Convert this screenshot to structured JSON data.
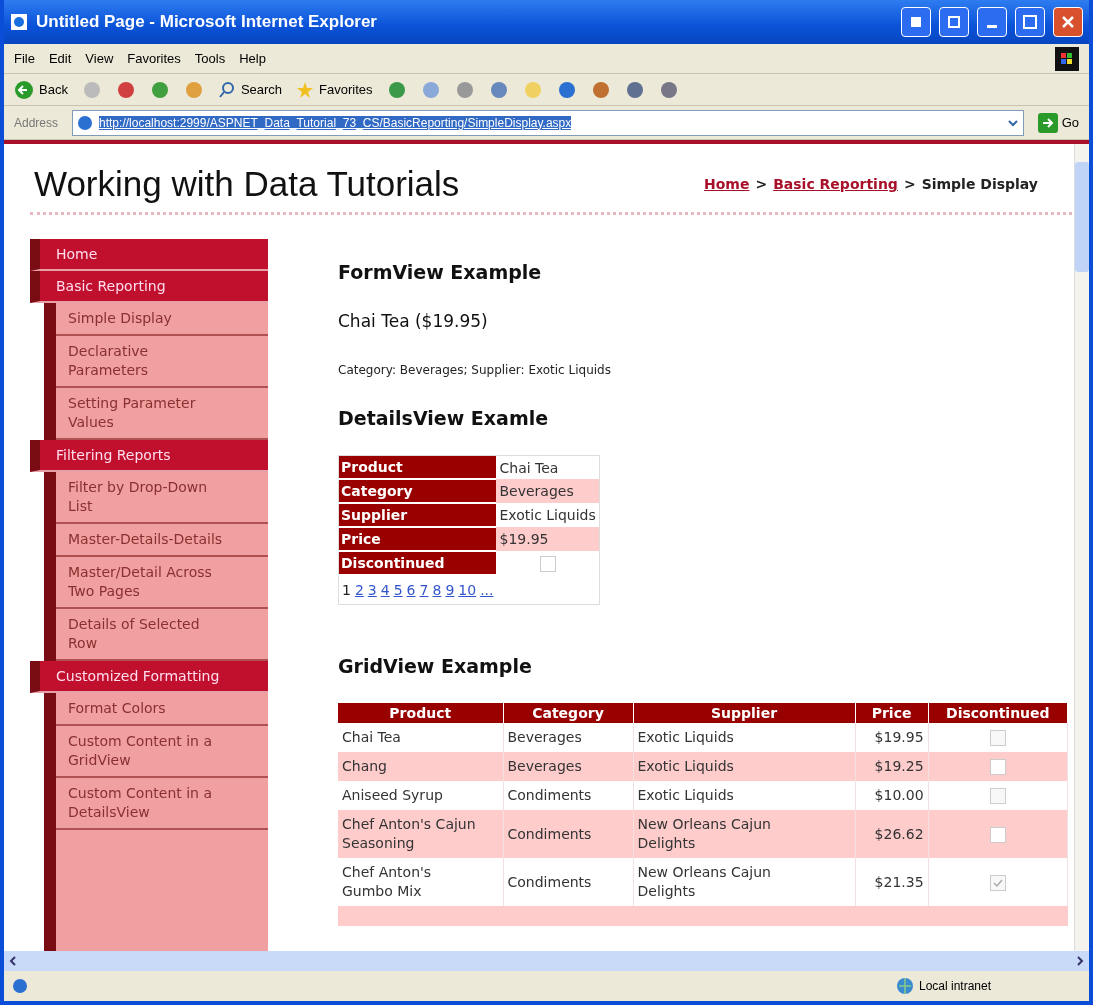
{
  "window": {
    "title": "Untitled Page - Microsoft Internet Explorer"
  },
  "menu_bar": [
    "File",
    "Edit",
    "View",
    "Favorites",
    "Tools",
    "Help"
  ],
  "toolbar": {
    "back": "Back",
    "search": "Search",
    "favorites": "Favorites"
  },
  "address_bar": {
    "label": "Address",
    "url": "http://localhost:2999/ASPNET_Data_Tutorial_73_CS/BasicReporting/SimpleDisplay.aspx",
    "go": "Go"
  },
  "page": {
    "site_title": "Working with Data Tutorials",
    "breadcrumb_separator": ">",
    "breadcrumb": [
      {
        "label": "Home",
        "kind": "link"
      },
      {
        "label": "Basic Reporting",
        "kind": "link"
      },
      {
        "label": "Simple Display",
        "kind": "current"
      }
    ]
  },
  "sidebar": [
    {
      "label": "Home"
    },
    {
      "label": "Basic Reporting",
      "children": [
        {
          "label": "Simple Display"
        },
        {
          "label": "Declarative Parameters"
        },
        {
          "label": "Setting Parameter Values"
        }
      ]
    },
    {
      "label": "Filtering Reports",
      "children": [
        {
          "label": "Filter by Drop-Down List"
        },
        {
          "label": "Master-Details-Details"
        },
        {
          "label": "Master/Detail Across Two Pages"
        },
        {
          "label": "Details of Selected Row"
        }
      ]
    },
    {
      "label": "Customized Formatting",
      "children": [
        {
          "label": "Format Colors"
        },
        {
          "label": "Custom Content in a GridView"
        },
        {
          "label": "Custom Content in a DetailsView"
        }
      ]
    }
  ],
  "formview": {
    "heading": "FormView Example",
    "product_line": "Chai Tea ($19.95)",
    "details_line": "Category: Beverages; Supplier: Exotic Liquids"
  },
  "detailsview": {
    "heading": "DetailsView Examle",
    "fields": [
      {
        "label": "Product",
        "value": "Chai Tea"
      },
      {
        "label": "Category",
        "value": "Beverages"
      },
      {
        "label": "Supplier",
        "value": "Exotic Liquids"
      },
      {
        "label": "Price",
        "value": "$19.95"
      }
    ],
    "discontinued": {
      "label": "Discontinued",
      "checked": false
    },
    "pager": [
      {
        "label": "1",
        "selected": true
      },
      {
        "label": "2",
        "selected": false
      },
      {
        "label": "3",
        "selected": false
      },
      {
        "label": "4",
        "selected": false
      },
      {
        "label": "5",
        "selected": false
      },
      {
        "label": "6",
        "selected": false
      },
      {
        "label": "7",
        "selected": false
      },
      {
        "label": "8",
        "selected": false
      },
      {
        "label": "9",
        "selected": false
      },
      {
        "label": "10",
        "selected": false
      },
      {
        "label": "...",
        "selected": false
      }
    ]
  },
  "gridview": {
    "heading": "GridView Example",
    "columns": [
      "Product",
      "Category",
      "Supplier",
      "Price",
      "Discontinued"
    ],
    "rows": [
      {
        "product": "Chai Tea",
        "category": "Beverages",
        "supplier": "Exotic Liquids",
        "price": "$19.95",
        "discontinued": false
      },
      {
        "product": "Chang",
        "category": "Beverages",
        "supplier": "Exotic Liquids",
        "price": "$19.25",
        "discontinued": false
      },
      {
        "product": "Aniseed Syrup",
        "category": "Condiments",
        "supplier": "Exotic Liquids",
        "price": "$10.00",
        "discontinued": false
      },
      {
        "product": "Chef Anton's Cajun Seasoning",
        "category": "Condiments",
        "supplier": "New Orleans Cajun Delights",
        "price": "$26.62",
        "discontinued": false
      },
      {
        "product": "Chef Anton's Gumbo Mix",
        "category": "Condiments",
        "supplier": "New Orleans Cajun Delights",
        "price": "$21.35",
        "discontinued": true
      }
    ]
  },
  "status_bar": {
    "zone": "Local intranet"
  }
}
